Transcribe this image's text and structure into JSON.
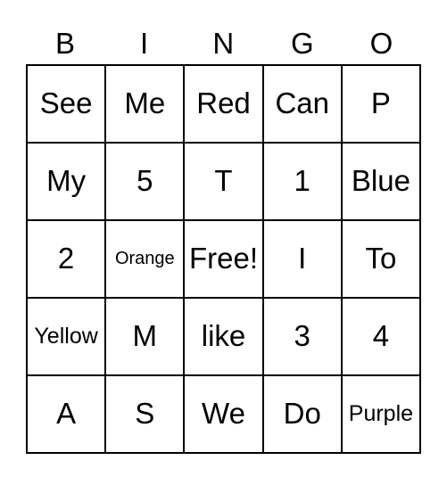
{
  "card": {
    "headers": [
      "B",
      "I",
      "N",
      "G",
      "O"
    ],
    "rows": [
      [
        {
          "text": "See",
          "size": "lg"
        },
        {
          "text": "Me",
          "size": "lg"
        },
        {
          "text": "Red",
          "size": "lg"
        },
        {
          "text": "Can",
          "size": "lg"
        },
        {
          "text": "P",
          "size": "lg"
        }
      ],
      [
        {
          "text": "My",
          "size": "lg"
        },
        {
          "text": "5",
          "size": "lg"
        },
        {
          "text": "T",
          "size": "lg"
        },
        {
          "text": "1",
          "size": "lg"
        },
        {
          "text": "Blue",
          "size": "lg"
        }
      ],
      [
        {
          "text": "2",
          "size": "lg"
        },
        {
          "text": "Orange",
          "size": "sm"
        },
        {
          "text": "Free!",
          "size": "lg"
        },
        {
          "text": "I",
          "size": "lg"
        },
        {
          "text": "To",
          "size": "lg"
        }
      ],
      [
        {
          "text": "Yellow",
          "size": "md"
        },
        {
          "text": "M",
          "size": "lg"
        },
        {
          "text": "like",
          "size": "lg"
        },
        {
          "text": "3",
          "size": "lg"
        },
        {
          "text": "4",
          "size": "lg"
        }
      ],
      [
        {
          "text": "A",
          "size": "lg"
        },
        {
          "text": "S",
          "size": "lg"
        },
        {
          "text": "We",
          "size": "lg"
        },
        {
          "text": "Do",
          "size": "lg"
        },
        {
          "text": "Purple",
          "size": "md"
        }
      ]
    ],
    "colors": {
      "text": "#000000",
      "border": "#000000",
      "background": "#ffffff"
    }
  }
}
